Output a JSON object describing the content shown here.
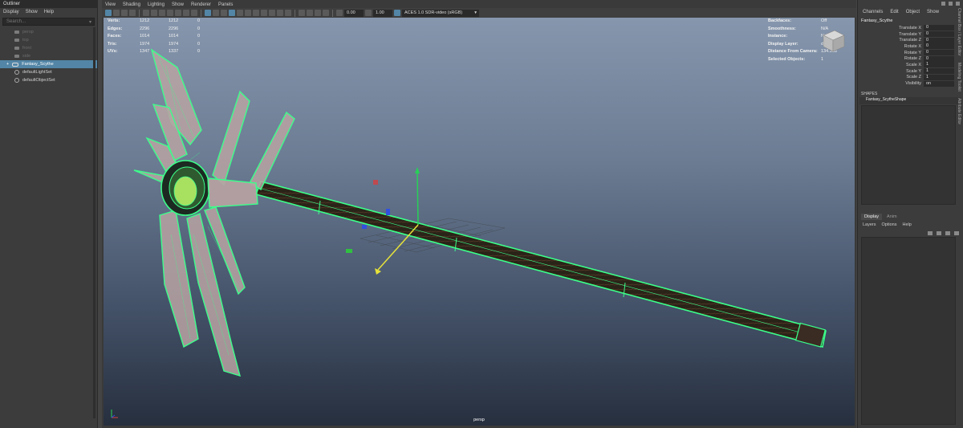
{
  "outliner": {
    "title": "Outliner",
    "menu": [
      "Display",
      "Show",
      "Help"
    ],
    "search_placeholder": "Search...",
    "items": [
      {
        "label": "persp",
        "kind": "camera",
        "state": "dim"
      },
      {
        "label": "top",
        "kind": "camera",
        "state": "dim"
      },
      {
        "label": "front",
        "kind": "camera",
        "state": "dim"
      },
      {
        "label": "side",
        "kind": "camera",
        "state": "dim"
      },
      {
        "label": "Fantasy_Scythe",
        "kind": "mesh",
        "state": "selected"
      },
      {
        "label": "defaultLightSet",
        "kind": "set",
        "state": "normal"
      },
      {
        "label": "defaultObjectSet",
        "kind": "set",
        "state": "normal"
      }
    ]
  },
  "viewport": {
    "menu": [
      "View",
      "Shading",
      "Lighting",
      "Show",
      "Renderer",
      "Panels"
    ],
    "exposure": "0.00",
    "gamma": "1.00",
    "color_space": "ACES 1.0 SDR-video (sRGB)",
    "camera_label": "persp",
    "hud_left": [
      {
        "label": "Verts:",
        "a": "1212",
        "b": "1212",
        "c": "0"
      },
      {
        "label": "Edges:",
        "a": "2296",
        "b": "2296",
        "c": "0"
      },
      {
        "label": "Faces:",
        "a": "1014",
        "b": "1014",
        "c": "0"
      },
      {
        "label": "Tris:",
        "a": "1974",
        "b": "1974",
        "c": "0"
      },
      {
        "label": "UVs:",
        "a": "1347",
        "b": "1337",
        "c": "0"
      }
    ],
    "hud_right": [
      {
        "label": "Backfaces:",
        "value": "Off"
      },
      {
        "label": "Smoothness:",
        "value": "N/A"
      },
      {
        "label": "Instance:",
        "value": "No"
      },
      {
        "label": "Display Layer:",
        "value": "default"
      },
      {
        "label": "Distance From Camera:",
        "value": "134.368"
      },
      {
        "label": "Selected Objects:",
        "value": "1"
      }
    ],
    "wire_color": "#3cff8a",
    "background_top": "#8696ad",
    "background_bottom": "#262f3e"
  },
  "channel_box": {
    "menu": [
      "Channels",
      "Edit",
      "Object",
      "Show"
    ],
    "object": "Fantasy_Scythe",
    "attributes": [
      {
        "label": "Translate X",
        "value": "0"
      },
      {
        "label": "Translate Y",
        "value": "0"
      },
      {
        "label": "Translate Z",
        "value": "0"
      },
      {
        "label": "Rotate X",
        "value": "0"
      },
      {
        "label": "Rotate Y",
        "value": "0"
      },
      {
        "label": "Rotate Z",
        "value": "0"
      },
      {
        "label": "Scale X",
        "value": "1"
      },
      {
        "label": "Scale Y",
        "value": "1"
      },
      {
        "label": "Scale Z",
        "value": "1"
      },
      {
        "label": "Visibility",
        "value": "on"
      }
    ],
    "shapes_header": "SHAPES",
    "shape": "Fantasy_ScytheShape",
    "side_tabs": [
      "Channel Box / Layer Editor",
      "Modeling Toolkit",
      "Attribute Editor"
    ]
  },
  "layer_editor": {
    "tabs": [
      "Display",
      "Anim"
    ],
    "menu": [
      "Layers",
      "Options",
      "Help"
    ]
  }
}
